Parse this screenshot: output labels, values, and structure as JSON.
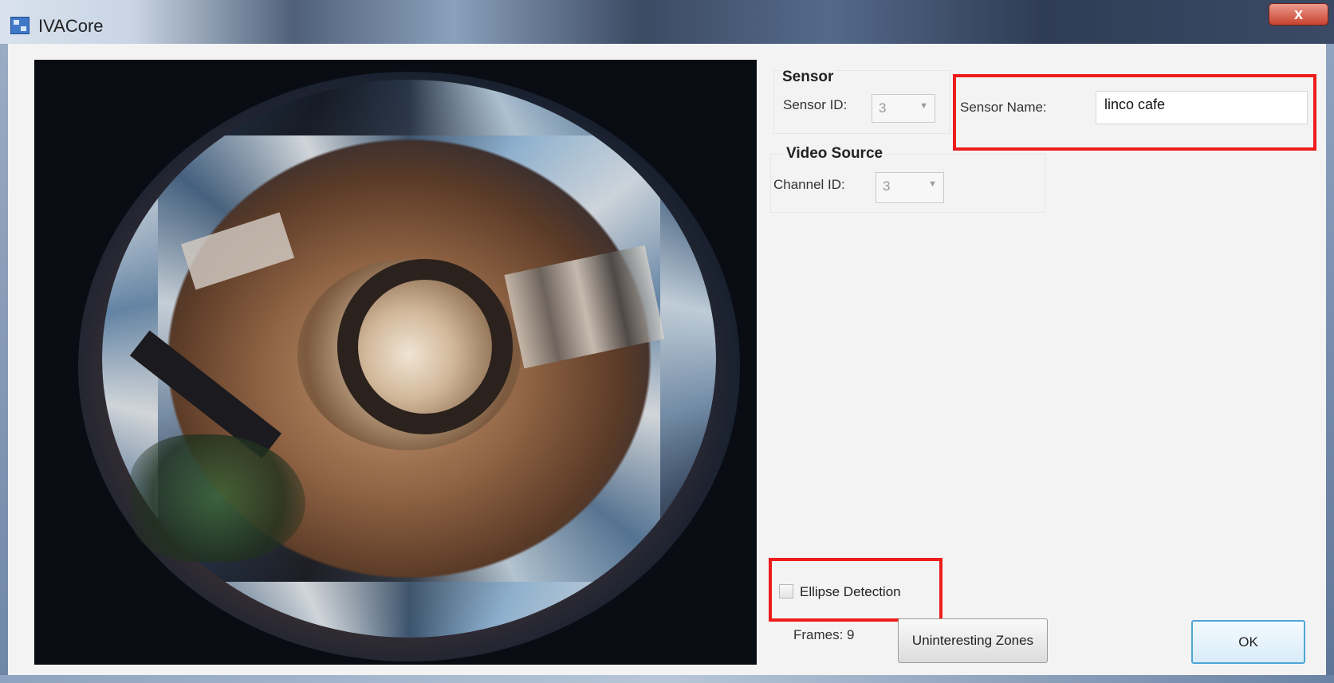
{
  "window": {
    "title": "IVACore",
    "close_label": "x"
  },
  "sensor_group": {
    "legend": "Sensor",
    "sensor_id_label": "Sensor ID:",
    "sensor_id_value": "3",
    "sensor_name_label": "Sensor Name:",
    "sensor_name_value": "linco cafe"
  },
  "video_group": {
    "legend": "Video Source",
    "channel_id_label": "Channel ID:",
    "channel_id_value": "3"
  },
  "ellipse_detection": {
    "label": "Ellipse Detection",
    "checked": false
  },
  "frames": {
    "text": "Frames: 9"
  },
  "buttons": {
    "uninteresting_zones": "Uninteresting Zones",
    "ok": "OK"
  },
  "icons": {
    "app": "app-window-icon",
    "dropdown": "chevron-down-icon",
    "close": "close-icon"
  },
  "colors": {
    "highlight": "#ee1c1c",
    "ok_border": "#4fa6d8"
  }
}
